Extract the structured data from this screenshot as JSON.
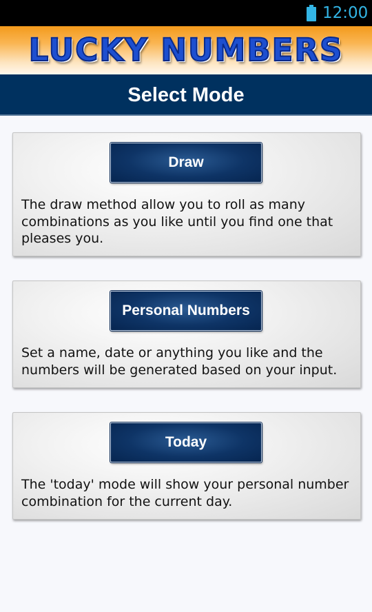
{
  "status_bar": {
    "time": "12:00",
    "battery_color": "#33b5e5"
  },
  "app": {
    "logo_text": "LUCKY NUMBERS"
  },
  "header": {
    "title": "Select Mode",
    "background": "#00315f"
  },
  "modes": [
    {
      "button_label": "Draw",
      "description": "The draw method allow you to roll as many combinations as you like until you find one that pleases you."
    },
    {
      "button_label": "Personal Numbers",
      "description": "Set a name, date or anything you like and the numbers will be generated based on your input."
    },
    {
      "button_label": "Today",
      "description": "The 'today' mode will show your personal number combination for the current day."
    }
  ],
  "icons": {
    "battery": "battery-icon"
  }
}
